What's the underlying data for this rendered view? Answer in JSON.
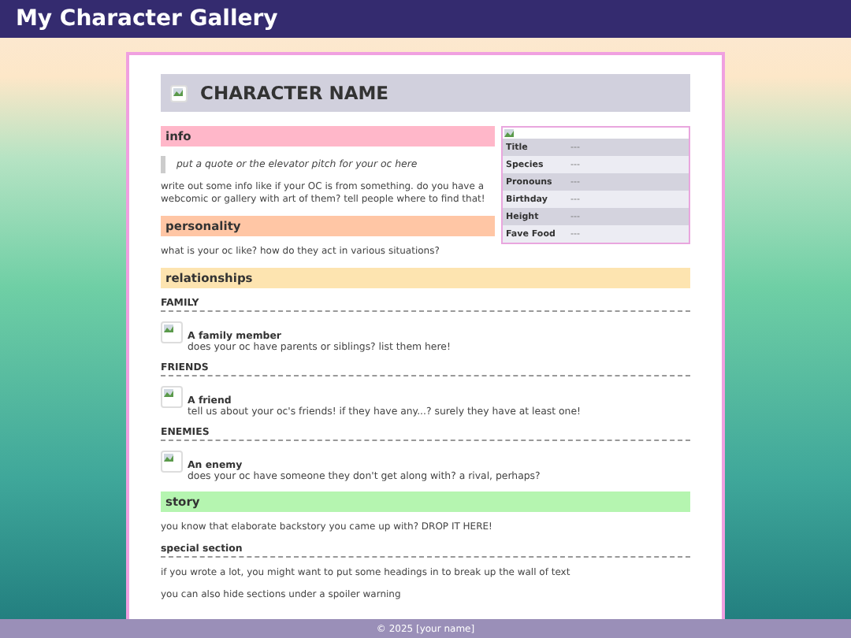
{
  "site_title": "My Character Gallery",
  "character_name": "CHARACTER NAME",
  "infobox": [
    {
      "label": "Title",
      "value": "---"
    },
    {
      "label": "Species",
      "value": "---"
    },
    {
      "label": "Pronouns",
      "value": "---"
    },
    {
      "label": "Birthday",
      "value": "---"
    },
    {
      "label": "Height",
      "value": "---"
    },
    {
      "label": "Fave Food",
      "value": "---"
    }
  ],
  "sections": [
    {
      "title": "info",
      "color": "#ffb7c9",
      "blocks": [
        {
          "kind": "quote",
          "text": "put a quote or the elevator pitch for your oc here"
        },
        {
          "kind": "paragraph",
          "text": "write out some info like if your OC is from something. do you have a webcomic or gallery with art of them? tell people where to find that!"
        }
      ]
    },
    {
      "title": "personality",
      "color": "#ffc6a5",
      "blocks": [
        {
          "kind": "paragraph",
          "text": "what is your oc like? how do they act in various situations?"
        }
      ]
    },
    {
      "title": "relationships",
      "color": "#fde4b0",
      "blocks": [
        {
          "kind": "subheading",
          "text": "FAMILY"
        },
        {
          "kind": "person",
          "name": "A family member",
          "text": "does your oc have parents or siblings? list them here!"
        },
        {
          "kind": "subheading",
          "text": "FRIENDS"
        },
        {
          "kind": "person",
          "name": "A friend",
          "text": "tell us about your oc's friends! if they have any...? surely they have at least one!"
        },
        {
          "kind": "subheading",
          "text": "ENEMIES"
        },
        {
          "kind": "person",
          "name": "An enemy",
          "text": "does your oc have someone they don't get along with? a rival, perhaps?"
        }
      ]
    },
    {
      "title": "story",
      "color": "#b5f5b0",
      "blocks": [
        {
          "kind": "paragraph",
          "text": "you know that elaborate backstory you came up with? DROP IT HERE!"
        },
        {
          "kind": "subheading",
          "text": "special section"
        },
        {
          "kind": "paragraph",
          "text": "if you wrote a lot, you might want to put some headings in to break up the wall of text"
        },
        {
          "kind": "paragraph",
          "text": "you can also hide sections under a spoiler warning"
        }
      ]
    }
  ],
  "footer": "© 2025 [your name]"
}
